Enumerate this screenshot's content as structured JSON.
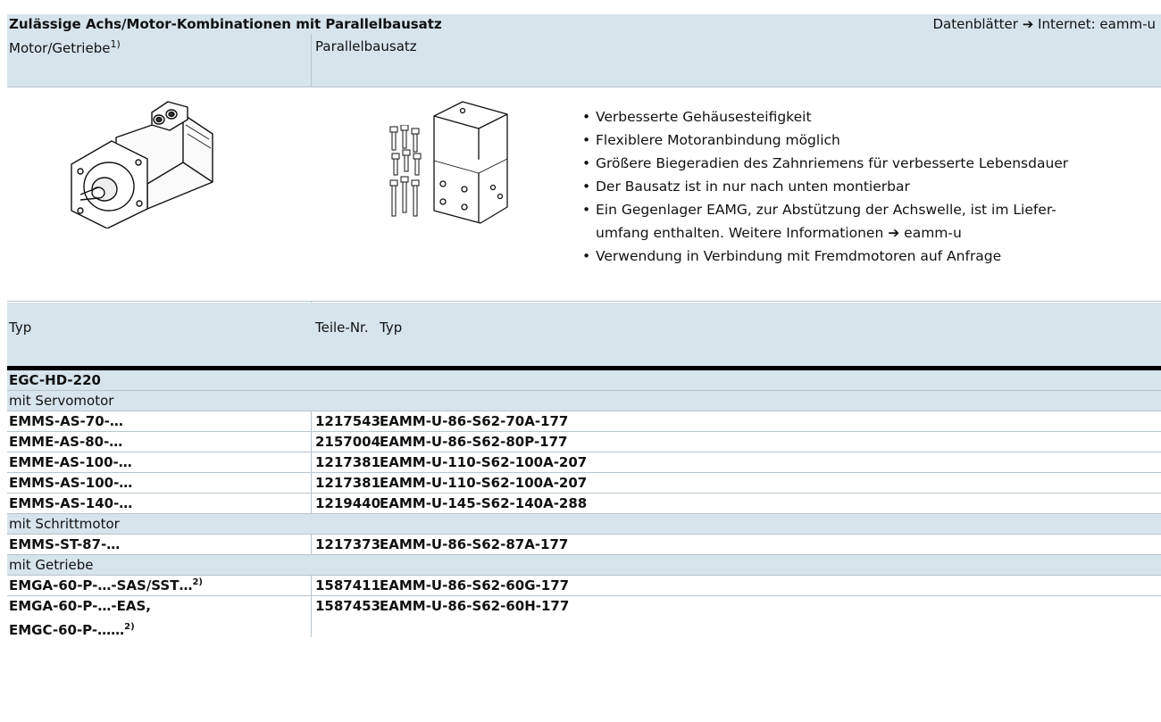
{
  "header": {
    "title": "Zulässige Achs/Motor-Kombinationen mit Parallelbausatz",
    "right_prefix": "Datenblätter",
    "right_arrow": "➔",
    "right_link": "Internet: eamm-u"
  },
  "table_header": {
    "col1": "Motor/Getriebe",
    "col1_sup": "1)",
    "col2": "Parallelbausatz"
  },
  "features": [
    "Verbesserte Gehäusesteifigkeit",
    "Flexiblere Motoranbindung möglich",
    "Größere Biegeradien des Zahnriemens für verbesserte Lebensdauer",
    "Der Bausatz ist in nur nach unten montierbar",
    "Ein Gegenlager EAMG, zur Abstützung der Achswelle, ist im Liefer-",
    "umfang enthalten. Weitere Informationen",
    "eamm-u",
    "Verwendung in Verbindung mit Fremdmotoren auf Anfrage"
  ],
  "column_labels": {
    "typ": "Typ",
    "teile_nr": "Teile-Nr.",
    "typ2": "Typ"
  },
  "axis": "EGC-HD-220",
  "groups": {
    "servo": "mit Servomotor",
    "stepper": "mit Schrittmotor",
    "gear": "mit Getriebe"
  },
  "rows": [
    {
      "motor": "EMMS-AS-70-…",
      "part": "1217543",
      "kit": "EAMM-U-86-S62-70A-177"
    },
    {
      "motor": "EMME-AS-80-…",
      "part": "2157004",
      "kit": "EAMM-U-86-S62-80P-177"
    },
    {
      "motor": "EMME-AS-100-…",
      "part": "1217381",
      "kit": "EAMM-U-110-S62-100A-207"
    },
    {
      "motor": "EMMS-AS-100-…",
      "part": "1217381",
      "kit": "EAMM-U-110-S62-100A-207"
    },
    {
      "motor": "EMMS-AS-140-…",
      "part": "1219440",
      "kit": "EAMM-U-145-S62-140A-288"
    },
    {
      "motor": "EMMS-ST-87-…",
      "part": "1217373",
      "kit": "EAMM-U-86-S62-87A-177"
    },
    {
      "motor": "EMGA-60-P-…-SAS/SST…",
      "motor_sup": "2)",
      "part": "1587411",
      "kit": "EAMM-U-86-S62-60G-177"
    },
    {
      "motor": "EMGA-60-P-…-EAS,",
      "motor_line2": "EMGC-60-P-……",
      "motor_sup": "2)",
      "part": "1587453",
      "kit": "EAMM-U-86-S62-60H-177"
    }
  ]
}
